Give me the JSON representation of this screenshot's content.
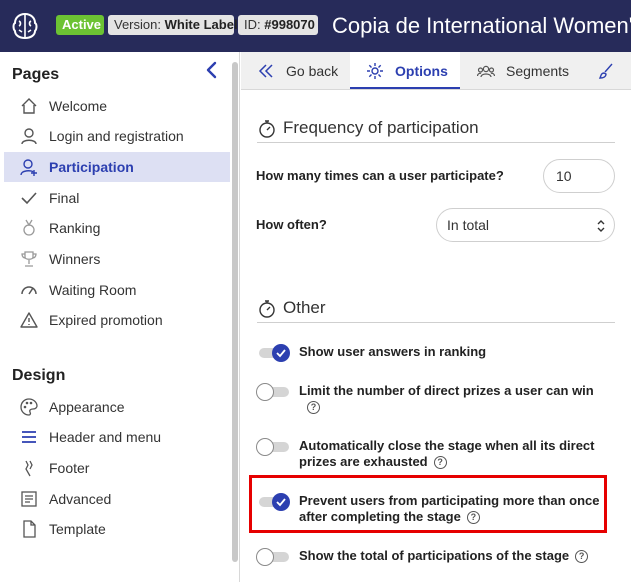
{
  "header": {
    "status_badge": "Active",
    "version_label": "Version:",
    "version_value": "White Label",
    "id_label": "ID:",
    "id_value": "#998070",
    "title": "Copia de International Women'"
  },
  "sidebar": {
    "pages_title": "Pages",
    "pages": [
      {
        "label": "Welcome",
        "icon": "home-icon"
      },
      {
        "label": "Login and registration",
        "icon": "user-icon"
      },
      {
        "label": "Participation",
        "icon": "user-add-icon",
        "active": true
      },
      {
        "label": "Final",
        "icon": "check-icon"
      },
      {
        "label": "Ranking",
        "icon": "medal-icon"
      },
      {
        "label": "Winners",
        "icon": "trophy-icon"
      },
      {
        "label": "Waiting Room",
        "icon": "gauge-icon"
      },
      {
        "label": "Expired promotion",
        "icon": "warning-icon"
      }
    ],
    "design_title": "Design",
    "design": [
      {
        "label": "Appearance",
        "icon": "palette-icon"
      },
      {
        "label": "Header and menu",
        "icon": "menu-icon"
      },
      {
        "label": "Footer",
        "icon": "footer-icon"
      },
      {
        "label": "Advanced",
        "icon": "code-icon"
      },
      {
        "label": "Template",
        "icon": "file-icon"
      }
    ]
  },
  "tabs": [
    {
      "label": "Go back",
      "icon": "double-chevron-left-icon"
    },
    {
      "label": "Options",
      "icon": "gear-icon",
      "active": true
    },
    {
      "label": "Segments",
      "icon": "users-icon"
    },
    {
      "label": "",
      "icon": "brush-icon"
    }
  ],
  "frequency": {
    "title": "Frequency of participation",
    "times_label": "How many times can a user participate?",
    "times_value": "10",
    "often_label": "How often?",
    "often_value": "In total"
  },
  "other": {
    "title": "Other",
    "toggles": [
      {
        "label": "Show user answers in ranking",
        "on": true,
        "help": false
      },
      {
        "label": "Limit the number of direct prizes a user can win",
        "on": false,
        "help": true
      },
      {
        "label": "Automatically close the stage when all its direct prizes are exhausted",
        "on": false,
        "help": true
      },
      {
        "label": "Prevent users from participating more than once after completing the stage",
        "on": true,
        "help": true
      },
      {
        "label": "Show the total of participations of the stage",
        "on": false,
        "help": true
      }
    ]
  },
  "colors": {
    "header_bg": "#272b5a",
    "accent": "#2c3fb0",
    "active_badge": "#6cc333",
    "highlight": "#e60000"
  }
}
